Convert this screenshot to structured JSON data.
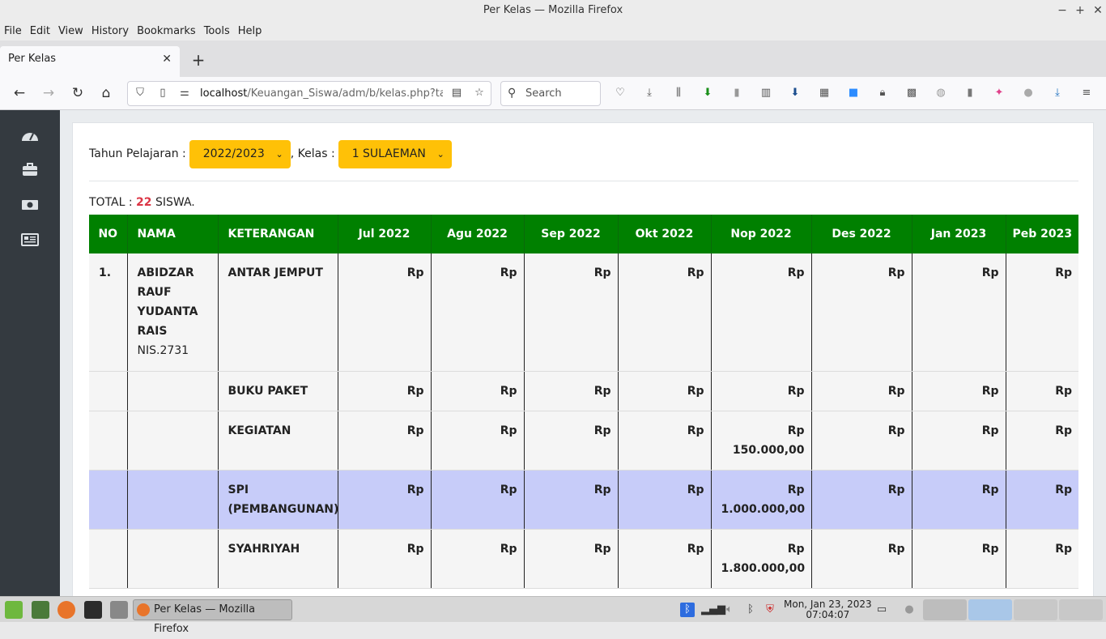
{
  "window": {
    "title": "Per Kelas — Mozilla Firefox",
    "minimize": "−",
    "maximize": "+",
    "close": "✕"
  },
  "menu": [
    "File",
    "Edit",
    "View",
    "History",
    "Bookmarks",
    "Tools",
    "Help"
  ],
  "tab": {
    "title": "Per Kelas",
    "close": "✕",
    "new_tab": "+"
  },
  "nav": {
    "url_host": "localhost",
    "url_path": "/Keuangan_Siswa/adm/b/kelas.php?tape",
    "search_placeholder": "Search"
  },
  "filters": {
    "year_label": "Tahun Pelajaran :",
    "year_value": "2022/2023",
    "class_label": ", Kelas :",
    "class_value": "1 SULAEMAN"
  },
  "total": {
    "prefix": "TOTAL :",
    "count": "22",
    "suffix": "SISWA."
  },
  "table": {
    "headers": [
      "NO",
      "NAMA",
      "KETERANGAN",
      "Jul 2022",
      "Agu 2022",
      "Sep 2022",
      "Okt 2022",
      "Nop 2022",
      "Des 2022",
      "Jan 2023",
      "Peb 2023"
    ],
    "student": {
      "no": "1.",
      "name": "ABIDZAR RAUF YUDANTA RAIS",
      "nis": "NIS.2731"
    },
    "rows": [
      {
        "ket": "ANTAR JEMPUT",
        "cells": [
          "Rp",
          "Rp",
          "Rp",
          "Rp",
          "Rp",
          "Rp",
          "Rp",
          "Rp"
        ]
      },
      {
        "ket": "BUKU PAKET",
        "cells": [
          "Rp",
          "Rp",
          "Rp",
          "Rp",
          "Rp",
          "Rp",
          "Rp",
          "Rp"
        ]
      },
      {
        "ket": "KEGIATAN",
        "cells": [
          "Rp",
          "Rp",
          "Rp",
          "Rp",
          "Rp 150.000,00",
          "Rp",
          "Rp",
          "Rp"
        ]
      },
      {
        "ket": "SPI (PEMBANGUNAN)",
        "cells": [
          "Rp",
          "Rp",
          "Rp",
          "Rp",
          "Rp 1.000.000,00",
          "Rp",
          "Rp",
          "Rp"
        ]
      },
      {
        "ket": "SYAHRIYAH",
        "cells": [
          "Rp",
          "Rp",
          "Rp",
          "Rp",
          "Rp 1.800.000,00",
          "Rp",
          "Rp",
          "Rp"
        ]
      }
    ]
  },
  "taskbar": {
    "task_label": "Per Kelas — Mozilla Firefox",
    "clock_date": "Mon, Jan 23, 2023",
    "clock_time": "07:04:07"
  },
  "colors": {
    "header_green": "#008000",
    "select_yellow": "#ffc107",
    "highlight_row": "#c7ccf9",
    "total_red": "#dc3545",
    "sidebar": "#343a40"
  }
}
